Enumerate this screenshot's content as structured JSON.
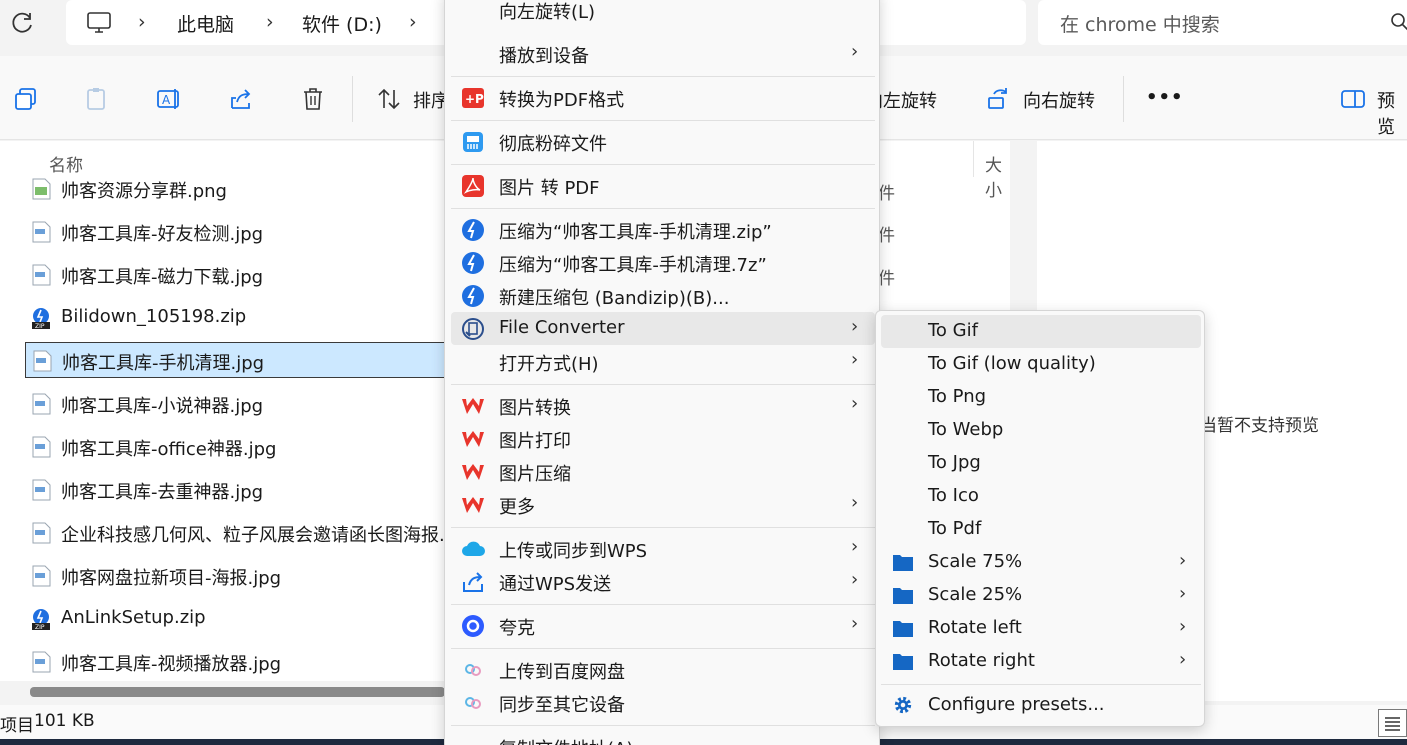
{
  "address_bar": {
    "breadcrumbs": [
      "此电脑",
      "软件 (D:)"
    ],
    "separator": "›",
    "search_placeholder": "在 chrome 中搜索"
  },
  "toolbar": {
    "sort_label": "排序",
    "rotate_left_label": "向左旋转",
    "rotate_right_label": "向右旋转",
    "more_label": "•••",
    "preview_label": "预览"
  },
  "file_list": {
    "column_name": "名称",
    "column_size": "大小",
    "type_header": "件",
    "type_cells": [
      "件",
      "件"
    ],
    "files": [
      {
        "name": "帅客资源分享群.png",
        "icon": "png-file-icon"
      },
      {
        "name": "帅客工具库-好友检测.jpg",
        "icon": "jpg-file-icon"
      },
      {
        "name": "帅客工具库-磁力下载.jpg",
        "icon": "jpg-file-icon"
      },
      {
        "name": "Bilidown_105198.zip",
        "icon": "zip-file-icon"
      },
      {
        "name": "帅客工具库-手机清理.jpg",
        "icon": "jpg-file-icon",
        "selected": true
      },
      {
        "name": "帅客工具库-小说神器.jpg",
        "icon": "jpg-file-icon"
      },
      {
        "name": "帅客工具库-office神器.jpg",
        "icon": "jpg-file-icon"
      },
      {
        "name": "帅客工具库-去重神器.jpg",
        "icon": "jpg-file-icon"
      },
      {
        "name": "企业科技感几何风、粒子风展会邀请函长图海报.",
        "icon": "jpg-file-icon"
      },
      {
        "name": "帅客网盘拉新项目-海报.jpg",
        "icon": "jpg-file-icon"
      },
      {
        "name": "AnLinkSetup.zip",
        "icon": "zip-file-icon"
      },
      {
        "name": "帅客工具库-视频播放器.jpg",
        "icon": "jpg-file-icon"
      }
    ]
  },
  "preview_pane": {
    "message": "当暂不支持预览"
  },
  "status_bar": {
    "items_fragment": "项目",
    "size": "101 KB"
  },
  "context_menu": {
    "items": [
      {
        "label": "向左旋转(L)",
        "icon": "rotate-left-icon"
      },
      {
        "label": "播放到设备",
        "icon": "",
        "submenu": true
      },
      {
        "label": "转换为PDF格式",
        "icon": "pdf-convert-icon"
      },
      {
        "label": "彻底粉碎文件",
        "icon": "shredder-icon"
      },
      {
        "label": "图片 转 PDF",
        "icon": "acrobat-icon"
      },
      {
        "label": "压缩为“帅客工具库-手机清理.zip”",
        "icon": "bandizip-icon"
      },
      {
        "label": "压缩为“帅客工具库-手机清理.7z”",
        "icon": "bandizip-icon"
      },
      {
        "label": "新建压缩包 (Bandizip)(B)...",
        "icon": "bandizip-icon"
      },
      {
        "label": "File Converter",
        "icon": "file-converter-icon",
        "submenu": true
      },
      {
        "label": "打开方式(H)",
        "icon": "",
        "submenu": true
      },
      {
        "label": "图片转换",
        "icon": "wps-icon",
        "submenu": true
      },
      {
        "label": "图片打印",
        "icon": "wps-icon"
      },
      {
        "label": "图片压缩",
        "icon": "wps-icon"
      },
      {
        "label": "更多",
        "icon": "wps-icon",
        "submenu": true
      },
      {
        "label": "上传或同步到WPS",
        "icon": "wps-cloud-icon",
        "submenu": true
      },
      {
        "label": "通过WPS发送",
        "icon": "share-icon",
        "submenu": true
      },
      {
        "label": "夸克",
        "icon": "quark-icon",
        "submenu": true
      },
      {
        "label": "上传到百度网盘",
        "icon": "baidu-netdisk-icon"
      },
      {
        "label": "同步至其它设备",
        "icon": "baidu-netdisk-icon"
      },
      {
        "label": "复制文件地址(A)",
        "icon": ""
      }
    ],
    "chevron": "›"
  },
  "submenu": {
    "items": [
      {
        "label": "To Gif",
        "icon": ""
      },
      {
        "label": "To Gif (low quality)",
        "icon": ""
      },
      {
        "label": "To Png",
        "icon": ""
      },
      {
        "label": "To Webp",
        "icon": ""
      },
      {
        "label": "To Jpg",
        "icon": ""
      },
      {
        "label": "To Ico",
        "icon": ""
      },
      {
        "label": "To Pdf",
        "icon": ""
      },
      {
        "label": "Scale 75%",
        "icon": "folder-icon",
        "submenu": true
      },
      {
        "label": "Scale 25%",
        "icon": "folder-icon",
        "submenu": true
      },
      {
        "label": "Rotate left",
        "icon": "folder-icon",
        "submenu": true
      },
      {
        "label": "Rotate right",
        "icon": "folder-icon",
        "submenu": true
      },
      {
        "label": "Configure presets...",
        "icon": "gear-icon"
      }
    ]
  },
  "colors": {
    "selection": "#cce8ff",
    "wps_red": "#e8352c",
    "bandizip_blue": "#1f6fe0",
    "folder_blue": "#1567c4"
  }
}
